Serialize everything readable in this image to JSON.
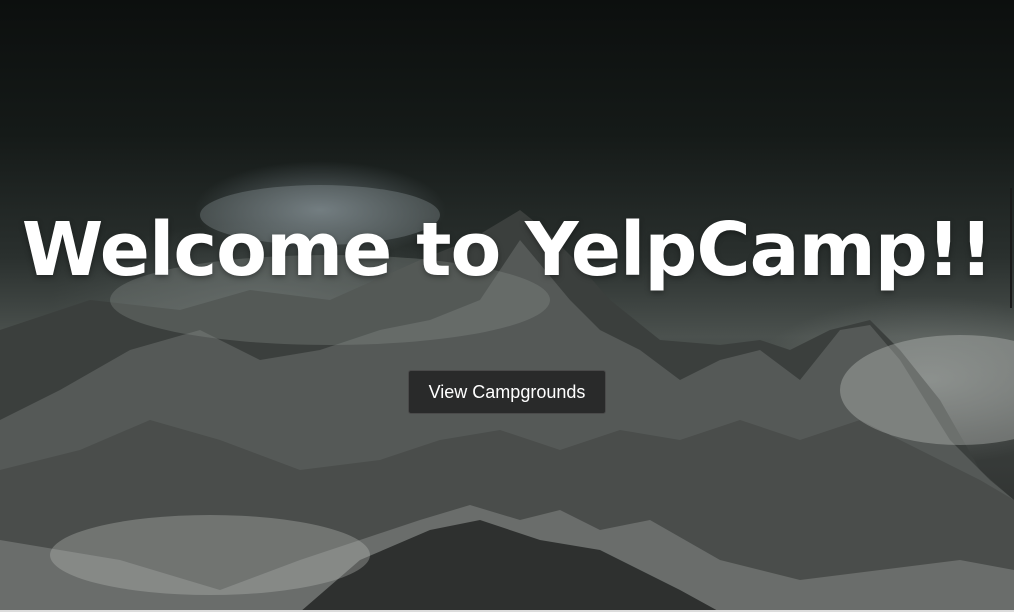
{
  "hero": {
    "headline": "Welcome to YelpCamp!!",
    "cta_label": "View Campgrounds"
  },
  "colors": {
    "headline": "#ffffff",
    "button_background": "#262626",
    "button_text": "#ffffff"
  }
}
